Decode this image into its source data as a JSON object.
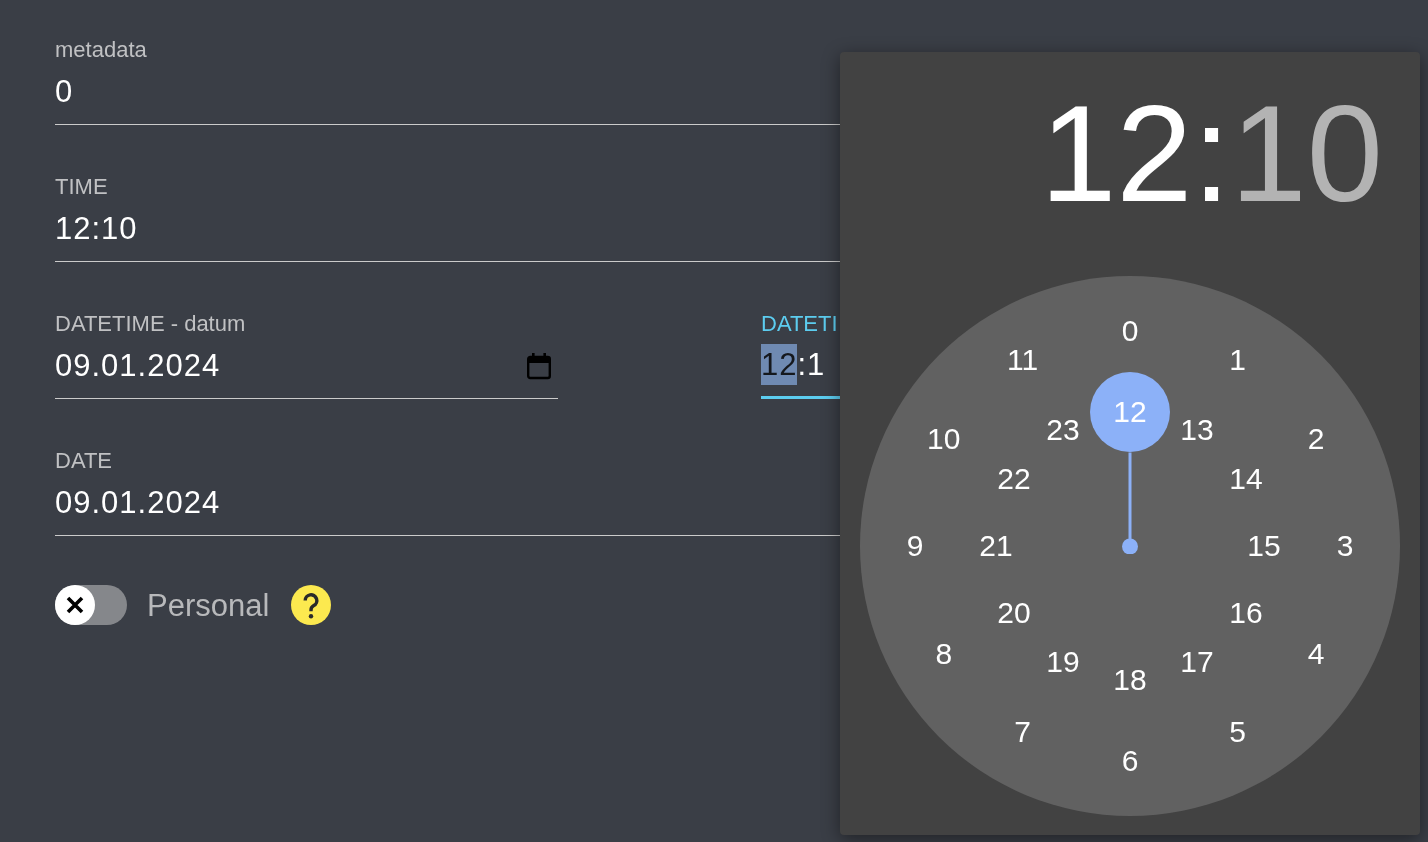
{
  "form": {
    "fields": [
      {
        "kind": "text",
        "label": "metadata",
        "value": "0"
      },
      {
        "kind": "text",
        "label": "TIME",
        "value": "12:10"
      },
      {
        "kind": "datetime",
        "date": {
          "label": "DATETIME - datum",
          "value": "09.01.2024"
        },
        "time": {
          "label": "DATETI",
          "focused": true,
          "hour": {
            "text": "12",
            "selected": true
          },
          "separator": ":",
          "minute": {
            "text": "1",
            "selected": false
          }
        }
      },
      {
        "kind": "text",
        "label": "DATE",
        "value": "09.01.2024"
      }
    ],
    "toggle": {
      "label": "Personal",
      "on": false
    }
  },
  "time_picker": {
    "header": {
      "hours": {
        "text": "12",
        "selected": true
      },
      "separator": ":",
      "minutes": {
        "text": "10",
        "selected": false
      }
    },
    "clock": {
      "outer_ring": [
        {
          "label": "0",
          "selected": false
        },
        {
          "label": "1",
          "selected": false
        },
        {
          "label": "2",
          "selected": false
        },
        {
          "label": "3",
          "selected": false
        },
        {
          "label": "4",
          "selected": false
        },
        {
          "label": "5",
          "selected": false
        },
        {
          "label": "6",
          "selected": false
        },
        {
          "label": "7",
          "selected": false
        },
        {
          "label": "8",
          "selected": false
        },
        {
          "label": "9",
          "selected": false
        },
        {
          "label": "10",
          "selected": false
        },
        {
          "label": "11",
          "selected": false
        }
      ],
      "inner_ring": [
        {
          "label": "12",
          "selected": true
        },
        {
          "label": "13",
          "selected": false
        },
        {
          "label": "14",
          "selected": false
        },
        {
          "label": "15",
          "selected": false
        },
        {
          "label": "16",
          "selected": false
        },
        {
          "label": "17",
          "selected": false
        },
        {
          "label": "18",
          "selected": false
        },
        {
          "label": "19",
          "selected": false
        },
        {
          "label": "20",
          "selected": false
        },
        {
          "label": "21",
          "selected": false
        },
        {
          "label": "22",
          "selected": false
        },
        {
          "label": "23",
          "selected": false
        }
      ]
    }
  }
}
